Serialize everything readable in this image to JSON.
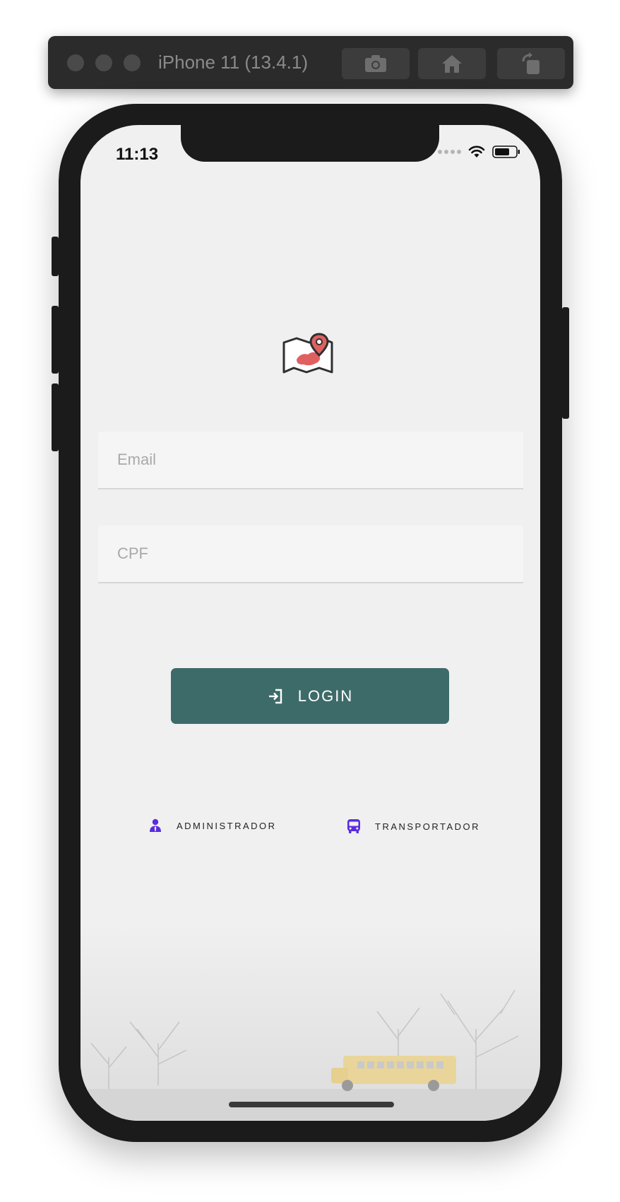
{
  "simulator": {
    "title": "iPhone 11 (13.4.1)",
    "buttons": [
      "camera-icon",
      "home-icon",
      "rotate-icon"
    ]
  },
  "status_bar": {
    "time": "11:13"
  },
  "form": {
    "email_placeholder": "Email",
    "cpf_placeholder": "CPF"
  },
  "login": {
    "label": "LOGIN",
    "color": "#3d6b69"
  },
  "roles": [
    {
      "label": "ADMINISTRADOR",
      "icon": "user-tie-icon"
    },
    {
      "label": "TRANSPORTADOR",
      "icon": "bus-icon"
    }
  ],
  "colors": {
    "accent": "#5b2be0",
    "map_pin": "#e06060",
    "screen_bg": "#f0f0f0"
  }
}
